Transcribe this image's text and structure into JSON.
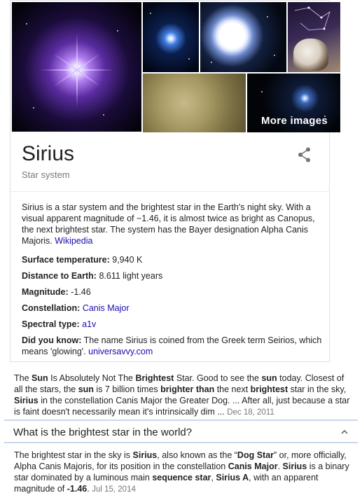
{
  "images": {
    "more_images_label": "More images"
  },
  "entity": {
    "title": "Sirius",
    "subtitle": "Star system",
    "share_icon": "share-icon"
  },
  "description": {
    "text": "Sirius is a star system and the brightest star in the Earth's night sky. With a visual apparent magnitude of −1.46, it is almost twice as bright as Canopus, the next brightest star. The system has the Bayer designation Alpha Canis Majoris.",
    "source": "Wikipedia"
  },
  "facts": [
    {
      "label": "Surface temperature:",
      "value": "9,940 K",
      "is_link": false
    },
    {
      "label": "Distance to Earth:",
      "value": "8.611 light years",
      "is_link": false
    },
    {
      "label": "Magnitude:",
      "value": "-1.46",
      "is_link": false
    },
    {
      "label": "Constellation:",
      "value": "Canis Major",
      "is_link": true
    },
    {
      "label": "Spectral type:",
      "value": "a1v",
      "is_link": true
    }
  ],
  "did_you_know": {
    "label": "Did you know:",
    "text": "The name Sirius is coined from the Greek term Seirios, which means 'glowing'.",
    "source": "universavvy.com"
  },
  "snippet": {
    "parts": [
      {
        "t": "The ",
        "b": false
      },
      {
        "t": "Sun",
        "b": true
      },
      {
        "t": " Is Absolutely Not The ",
        "b": false
      },
      {
        "t": "Brightest",
        "b": true
      },
      {
        "t": " Star. Good to see the ",
        "b": false
      },
      {
        "t": "sun",
        "b": true
      },
      {
        "t": " today. Closest of all the stars, the ",
        "b": false
      },
      {
        "t": "sun",
        "b": true
      },
      {
        "t": " is 7 billion times ",
        "b": false
      },
      {
        "t": "brighter than",
        "b": true
      },
      {
        "t": " the next ",
        "b": false
      },
      {
        "t": "brightest",
        "b": true
      },
      {
        "t": " star in the sky, ",
        "b": false
      },
      {
        "t": "Sirius",
        "b": true
      },
      {
        "t": " in the constellation Canis Major the Greater Dog. ... After all, just because a star is faint doesn't necessarily mean it's intrinsically dim ... ",
        "b": false
      }
    ],
    "date": "Dec 18, 2011"
  },
  "question": {
    "text": "What is the brightest star in the world?",
    "chevron_icon": "chevron-up-icon"
  },
  "answer": {
    "parts": [
      {
        "t": "The brightest star in the sky is ",
        "b": false
      },
      {
        "t": "Sirius",
        "b": true
      },
      {
        "t": ", also known as the “",
        "b": false
      },
      {
        "t": "Dog Star",
        "b": true
      },
      {
        "t": "” or, more officially, Alpha Canis Majoris, for its position in the constellation ",
        "b": false
      },
      {
        "t": "Canis Major",
        "b": true
      },
      {
        "t": ". ",
        "b": false
      },
      {
        "t": "Sirius",
        "b": true
      },
      {
        "t": " is a binary star dominated by a luminous main ",
        "b": false
      },
      {
        "t": "sequence star",
        "b": true
      },
      {
        "t": ", ",
        "b": false
      },
      {
        "t": "Sirius A",
        "b": true
      },
      {
        "t": ", with an apparent magnitude of ",
        "b": false
      },
      {
        "t": "-1.46",
        "b": true
      },
      {
        "t": ". ",
        "b": false
      }
    ],
    "date": "Jul 15, 2014"
  },
  "colors": {
    "link": "#1a0dab",
    "muted": "#777777",
    "divider": "#c9d7ee"
  }
}
